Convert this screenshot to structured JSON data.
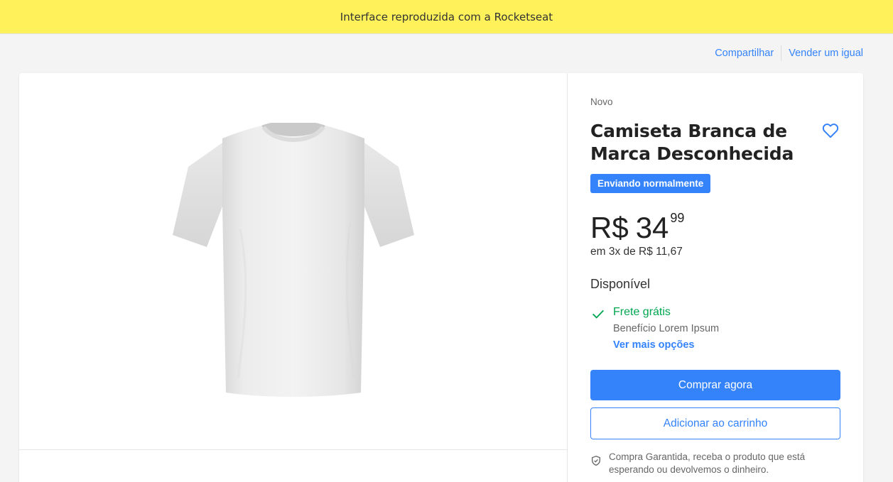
{
  "banner": {
    "text": "Interface reproduzida com a Rocketseat"
  },
  "top_links": {
    "share": "Compartilhar",
    "sell": "Vender um igual"
  },
  "product": {
    "condition": "Novo",
    "title": "Camiseta Branca de Marca Desconhecida",
    "badge": "Enviando normalmente",
    "price": {
      "currency": "R$",
      "integer": "34",
      "cents": "99"
    },
    "installments": "em 3x de R$ 11,67",
    "stock": "Disponível",
    "shipping": {
      "free": "Frete grátis",
      "benefit": "Benefício Lorem Ipsum",
      "more": "Ver mais opções"
    },
    "buttons": {
      "buy": "Comprar agora",
      "cart": "Adicionar ao carrinho"
    },
    "guarantee": "Compra Garantida, receba o produto que está esperando ou devolvemos o dinheiro."
  },
  "icons": {
    "favorite": "heart-outline-icon",
    "shipping_check": "check-icon",
    "guarantee": "shield-check-icon"
  },
  "colors": {
    "banner": "#fff159",
    "accent": "#3483fa",
    "success": "#00a650",
    "background": "#f4f4f4"
  }
}
